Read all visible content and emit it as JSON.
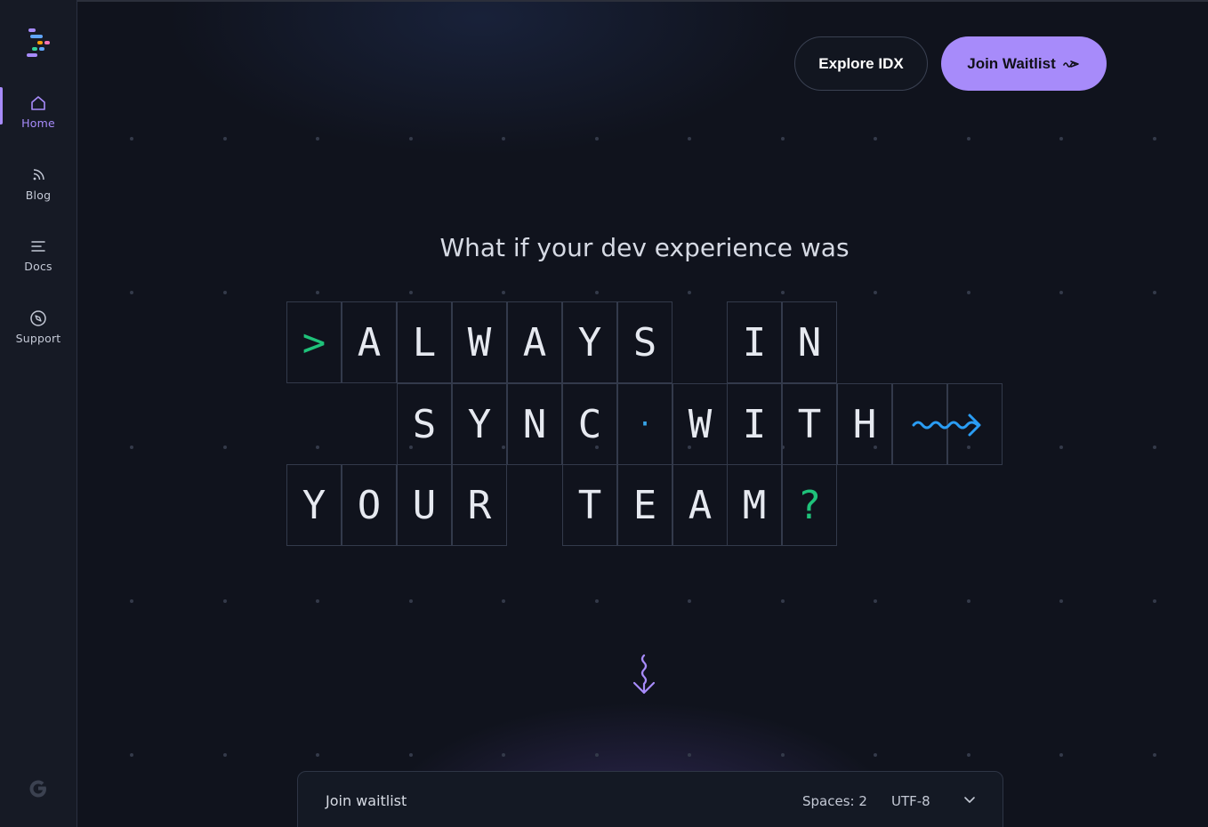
{
  "sidebar": {
    "items": [
      {
        "label": "Home",
        "icon": "home-icon",
        "active": true
      },
      {
        "label": "Blog",
        "icon": "rss-icon",
        "active": false
      },
      {
        "label": "Docs",
        "icon": "docs-icon",
        "active": false
      },
      {
        "label": "Support",
        "icon": "compass-icon",
        "active": false
      }
    ]
  },
  "header": {
    "explore_label": "Explore IDX",
    "join_label": "Join Waitlist"
  },
  "hero": {
    "headline": "What if your dev experience was",
    "row1": [
      ">",
      "A",
      "L",
      "W",
      "A",
      "Y",
      "S",
      "",
      "I",
      "N"
    ],
    "row2": [
      "S",
      "Y",
      "N",
      "C",
      "·",
      "W",
      "I",
      "T",
      "H"
    ],
    "row3": [
      "Y",
      "O",
      "U",
      "R",
      "",
      "T",
      "E",
      "A",
      "M",
      "?"
    ]
  },
  "status_bar": {
    "left": "Join waitlist",
    "spaces": "Spaces: 2",
    "encoding": "UTF-8"
  },
  "colors": {
    "accent": "#a78bfa",
    "green": "#1fc27a",
    "blue": "#38a4e8",
    "background": "#10131d"
  }
}
